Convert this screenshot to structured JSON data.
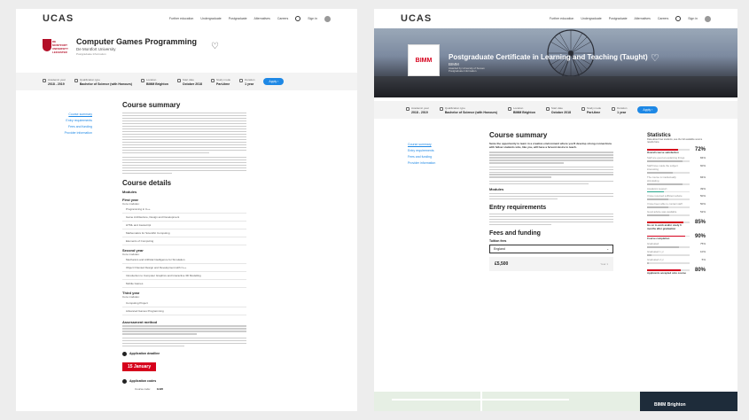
{
  "nav": {
    "logo": "UCAS",
    "links": [
      "Further education",
      "Undergraduate",
      "Postgraduate",
      "Alternatives",
      "Careers"
    ],
    "signin": "Sign in"
  },
  "nav_right": {
    "logo": "UCAS",
    "links": [
      "Further education",
      "Undergraduate",
      "Postgraduate",
      "Alternatives",
      "Careers"
    ],
    "signin": "Sign in"
  },
  "left": {
    "uni_logo_text": "DE MONTFORT UNIVERSITY LEICESTER",
    "title": "Computer Games Programming",
    "provider": "De Montfort University",
    "subtitle": "Postgraduate Information",
    "info": [
      {
        "label": "Academic year",
        "value": "2018 - 2019"
      },
      {
        "label": "Qualification type",
        "value": "Bachelor of Science (with Honours)"
      },
      {
        "label": "Location",
        "value": "BIMM Brighton"
      },
      {
        "label": "Start date",
        "value": "October 2018"
      },
      {
        "label": "Study mode",
        "value": "Part-time"
      },
      {
        "label": "Duration",
        "value": "1 year"
      }
    ],
    "apply": "Apply",
    "sidenav": [
      "Course summary",
      "Entry requirements",
      "Fees and funding",
      "Provider information"
    ],
    "course_summary_title": "Course summary",
    "course_details_title": "Course details",
    "modules_label": "Modules",
    "first_year": "First year",
    "core_modules": "Core modules:",
    "first_year_modules": [
      "Programming in C++",
      "Game Architecture, Design and Development",
      "HTML and Javascript",
      "Mathematics for Scientific Computing",
      "Elements of Computing"
    ],
    "second_year": "Second year",
    "second_year_modules": [
      "Mechanics and Artificial Intelligence for Simulation",
      "Object Oriented Design and Development with C++",
      "Introduction to Computer Graphics and Interactive 3D Modelling",
      "Mobile Games"
    ],
    "third_year": "Third year",
    "third_year_modules": [
      "Computing Project",
      "Advanced Games Programming"
    ],
    "assessment_title": "Assessment method",
    "deadline_label": "Application deadline",
    "deadline_value": "15 January",
    "codes_label": "Application codes",
    "course_code_label": "Course code:",
    "course_code_value": "G426"
  },
  "right": {
    "logo_text": "BIMM",
    "title": "Postgraduate Certificate in Learning and Teaching (Taught)",
    "provider": "BIMM",
    "subtitle": "Awarded by University of Sussex",
    "subtitle2": "Postgraduate Information",
    "info": [
      {
        "label": "Academic year",
        "value": "2018 - 2019"
      },
      {
        "label": "Qualification type",
        "value": "Bachelor of Science (with Honours)"
      },
      {
        "label": "Location",
        "value": "BIMM Brighton"
      },
      {
        "label": "Start date",
        "value": "October 2018"
      },
      {
        "label": "Study mode",
        "value": "Part-time"
      },
      {
        "label": "Duration",
        "value": "1 year"
      }
    ],
    "apply": "Apply",
    "sidenav": [
      "Course summary",
      "Entry requirements",
      "Fees and funding",
      "Provider information"
    ],
    "course_summary_title": "Course summary",
    "intro": "Seize the opportunity to learn in a creative environment where you'll develop strong connections with fellow students who, like you, will have a fervent desire to teach.",
    "modules_label": "Modules",
    "entry_title": "Entry requirements",
    "fees_title": "Fees and funding",
    "tuition_label": "Tuition fees",
    "fee_region": "England",
    "fee_amount": "£5,500",
    "fee_period": "Year 1",
    "map_card": "BIMM Brighton",
    "stats": {
      "title": "Statistics",
      "desc": "Data about how students, see the full available source results here",
      "rows": [
        {
          "label": "Overall course satisfaction",
          "value": "72%",
          "big": true,
          "fill": 0.72,
          "color": "#d6001c"
        },
        {
          "label": "Staff are good at explaining things",
          "value": "84%",
          "big": false,
          "fill": 0.84,
          "color": "#bbb"
        },
        {
          "label": "Staff have made the subject interesting",
          "value": "60%",
          "big": false,
          "fill": 0.6,
          "color": "#bbb"
        },
        {
          "label": "The course is intellectually stimulating",
          "value": "84%",
          "big": false,
          "fill": 0.84,
          "color": "#bbb"
        },
        {
          "label": "Academic support",
          "value": "39%",
          "big": false,
          "fill": 0.39,
          "color": "#2aa88f"
        },
        {
          "label": "I have received sufficient advice",
          "value": "50%",
          "big": false,
          "fill": 0.5,
          "color": "#bbb"
        },
        {
          "label": "I have been able to contact staff",
          "value": "50%",
          "big": false,
          "fill": 0.5,
          "color": "#bbb"
        },
        {
          "label": "Good advice was available",
          "value": "52%",
          "big": false,
          "fill": 0.52,
          "color": "#bbb"
        },
        {
          "label": "Go on to work and/or study 6 months after graduation",
          "value": "85%",
          "big": true,
          "fill": 0.85,
          "color": "#d6001c"
        },
        {
          "label": "Course completion",
          "value": "90%",
          "big": true,
          "fill": 0.9,
          "color": "#d6001c"
        },
        {
          "label": "Graduated",
          "value": "75%",
          "big": false,
          "fill": 0.75,
          "color": "#bbb"
        },
        {
          "label": "Graduated 1 yr",
          "value": "10%",
          "big": false,
          "fill": 0.1,
          "color": "#bbb"
        },
        {
          "label": "Graduated 2 yr",
          "value": "5%",
          "big": false,
          "fill": 0.05,
          "color": "#bbb"
        },
        {
          "label": "Applicants accepted onto course",
          "value": "80%",
          "big": true,
          "fill": 0.8,
          "color": "#d6001c"
        }
      ]
    }
  },
  "colors": {
    "accent": "#d6001c",
    "link": "#1e88e5"
  }
}
